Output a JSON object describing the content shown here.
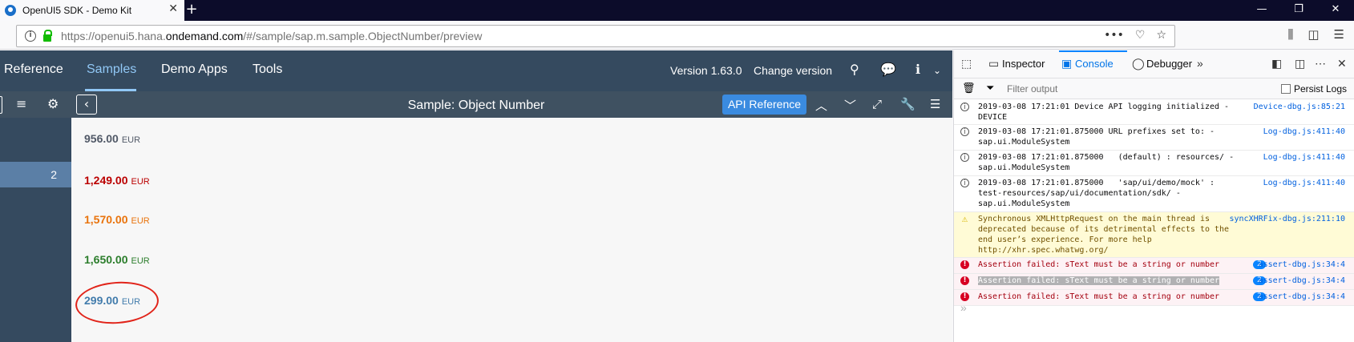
{
  "browser": {
    "tab_title": "OpenUI5 SDK - Demo Kit",
    "tab_close": "✕",
    "new_tab": "+",
    "url_prefix": "https://openui5.hana.",
    "url_host": "ondemand.com",
    "url_path": "/#/sample/sap.m.sample.ObjectNumber/preview",
    "url_more": "•••"
  },
  "shell": {
    "nav": [
      "Reference",
      "Samples",
      "Demo Apps",
      "Tools"
    ],
    "active_nav": "Samples",
    "version": "Version 1.63.0",
    "change_version": "Change version"
  },
  "subheader": {
    "title": "Sample: Object Number",
    "api_reference": "API Reference"
  },
  "sidebar": {
    "selected_item": "2"
  },
  "object_numbers": [
    {
      "value": "956.00",
      "unit": "EUR",
      "state": "None",
      "color": "#515967"
    },
    {
      "value": "1,249.00",
      "unit": "EUR",
      "state": "Error",
      "color": "#bb0000"
    },
    {
      "value": "1,570.00",
      "unit": "EUR",
      "state": "Warning",
      "color": "#e9730c"
    },
    {
      "value": "1,650.00",
      "unit": "EUR",
      "state": "Success",
      "color": "#2b7d2b"
    },
    {
      "value": "299.00",
      "unit": "EUR",
      "state": "Information",
      "color": "#427cac"
    }
  ],
  "devtools": {
    "tabs": [
      "Inspector",
      "Console",
      "Debugger"
    ],
    "active_tab": "Console",
    "filter_placeholder": "Filter output",
    "persist_logs": "Persist Logs",
    "prompt": "»",
    "logs": [
      {
        "level": "info",
        "message": "2019-03-08 17:21:01 Device API logging initialized - DEVICE",
        "source": "Device-dbg.js:85:21"
      },
      {
        "level": "info",
        "message": "2019-03-08 17:21:01.875000 URL prefixes set to: - sap.ui.ModuleSystem",
        "source": "Log-dbg.js:411:40"
      },
      {
        "level": "info",
        "message": "2019-03-08 17:21:01.875000   (default) : resources/ - sap.ui.ModuleSystem",
        "source": "Log-dbg.js:411:40"
      },
      {
        "level": "info",
        "message": "2019-03-08 17:21:01.875000   'sap/ui/demo/mock' : test-resources/sap/ui/documentation/sdk/ - sap.ui.ModuleSystem",
        "source": "Log-dbg.js:411:40"
      },
      {
        "level": "warn",
        "message": "Synchronous XMLHttpRequest on the main thread is deprecated because of its detrimental effects to the end user’s experience. For more help http://xhr.spec.whatwg.org/",
        "source": "syncXHRFix-dbg.js:211:10"
      },
      {
        "level": "error",
        "message": "Assertion failed: sText must be a string or number",
        "count": "2",
        "source": "assert-dbg.js:34:4"
      },
      {
        "level": "error",
        "message": "Assertion failed: sText must be a string or number",
        "count": "2",
        "source": "assert-dbg.js:34:4",
        "selected": true
      },
      {
        "level": "error",
        "message": "Assertion failed: sText must be a string or number",
        "count": "2",
        "source": "assert-dbg.js:34:4"
      }
    ]
  }
}
